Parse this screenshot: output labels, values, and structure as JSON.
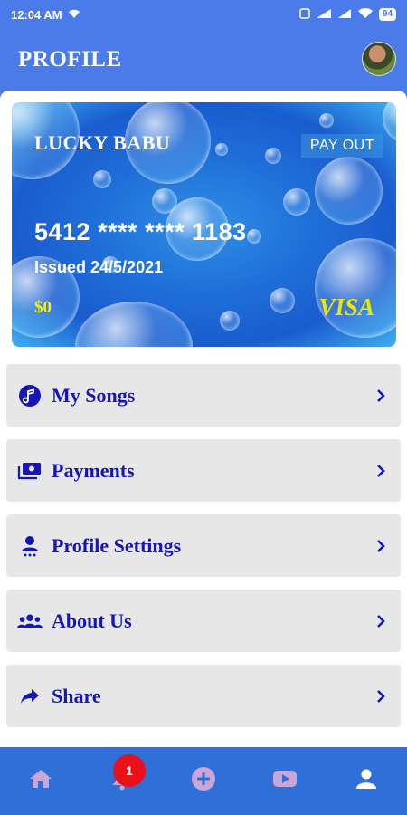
{
  "status_bar": {
    "time": "12:04 AM",
    "battery": "94",
    "icons": [
      "wifi-icon",
      "sim-icon",
      "signal-icon",
      "signal-icon",
      "wifi-icon",
      "battery-icon"
    ]
  },
  "header": {
    "title": "PROFILE"
  },
  "card": {
    "holder_name": "LUCKY BABU",
    "payout_label": "PAY OUT",
    "number": "5412 **** **** 1183",
    "issued": "Issued 24/5/2021",
    "balance": "$0",
    "brand": "VISA"
  },
  "menu": {
    "items": [
      {
        "label": "My Songs",
        "icon": "music-note-icon"
      },
      {
        "label": "Payments",
        "icon": "payments-icon"
      },
      {
        "label": "Profile Settings",
        "icon": "person-settings-icon"
      },
      {
        "label": "About Us",
        "icon": "group-icon"
      },
      {
        "label": "Share",
        "icon": "share-arrow-icon"
      }
    ]
  },
  "bottom_nav": {
    "items": [
      "home-icon",
      "bell-icon",
      "add-circle-icon",
      "youtube-icon",
      "person-icon"
    ],
    "notification_count": "1"
  },
  "colors": {
    "header_bg": "#4a7be8",
    "nav_bg": "#2f6fd8",
    "menu_text": "#1515b8",
    "menu_bg": "#e7e7e7",
    "badge": "#e8111a",
    "nav_icon_inactive": "#c9a6d8",
    "nav_icon_active": "#ffffff"
  }
}
